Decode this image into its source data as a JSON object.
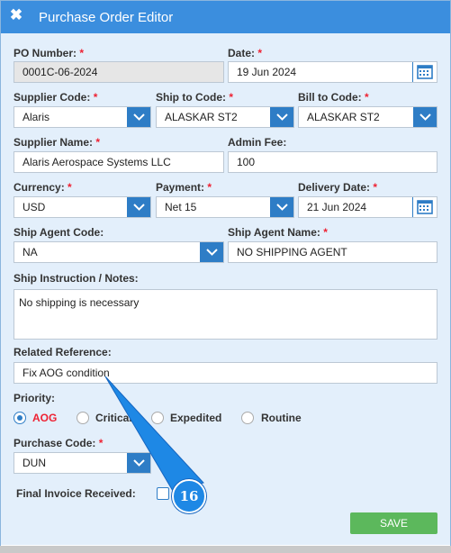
{
  "window": {
    "title": "Purchase Order Editor",
    "close_icon": "close-x-icon"
  },
  "form": {
    "po_number": {
      "label": "PO Number:",
      "required": "*",
      "value": "0001C-06-2024"
    },
    "date": {
      "label": "Date:",
      "required": "*",
      "value": "19 Jun 2024"
    },
    "supplier_code": {
      "label": "Supplier Code:",
      "required": "*",
      "value": "Alaris"
    },
    "ship_to_code": {
      "label": "Ship to Code:",
      "required": "*",
      "value": "ALASKAR ST2"
    },
    "bill_to_code": {
      "label": "Bill to Code:",
      "required": "*",
      "value": "ALASKAR ST2"
    },
    "supplier_name": {
      "label": "Supplier Name:",
      "required": "*",
      "value": "Alaris Aerospace Systems LLC"
    },
    "admin_fee": {
      "label": "Admin Fee:",
      "value": "100"
    },
    "currency": {
      "label": "Currency:",
      "required": "*",
      "value": "USD"
    },
    "payment": {
      "label": "Payment:",
      "required": "*",
      "value": "Net 15"
    },
    "delivery_date": {
      "label": "Delivery Date:",
      "required": "*",
      "value": "21 Jun 2024"
    },
    "ship_agent_code": {
      "label": "Ship Agent Code:",
      "value": "NA"
    },
    "ship_agent_name": {
      "label": "Ship Agent Name:",
      "required": "*",
      "value": "NO SHIPPING AGENT"
    },
    "ship_instruction": {
      "label": "Ship Instruction / Notes:",
      "value": "No shipping is necessary"
    },
    "related_reference": {
      "label": "Related Reference:",
      "value": "Fix AOG condition"
    },
    "priority": {
      "label": "Priority:",
      "options": [
        "AOG",
        "Critical",
        "Expedited",
        "Routine"
      ],
      "selected": "AOG"
    },
    "purchase_code": {
      "label": "Purchase Code:",
      "required": "*",
      "value": "DUN"
    },
    "final_invoice": {
      "label": "Final Invoice Received:",
      "checked": false
    }
  },
  "actions": {
    "save_label": "SAVE"
  },
  "annotation": {
    "step_number": "16"
  },
  "colors": {
    "titlebar": "#3b8ede",
    "accent": "#2e7dc6",
    "required": "#e23",
    "save": "#5cb85c",
    "panel": "#e3effb"
  }
}
